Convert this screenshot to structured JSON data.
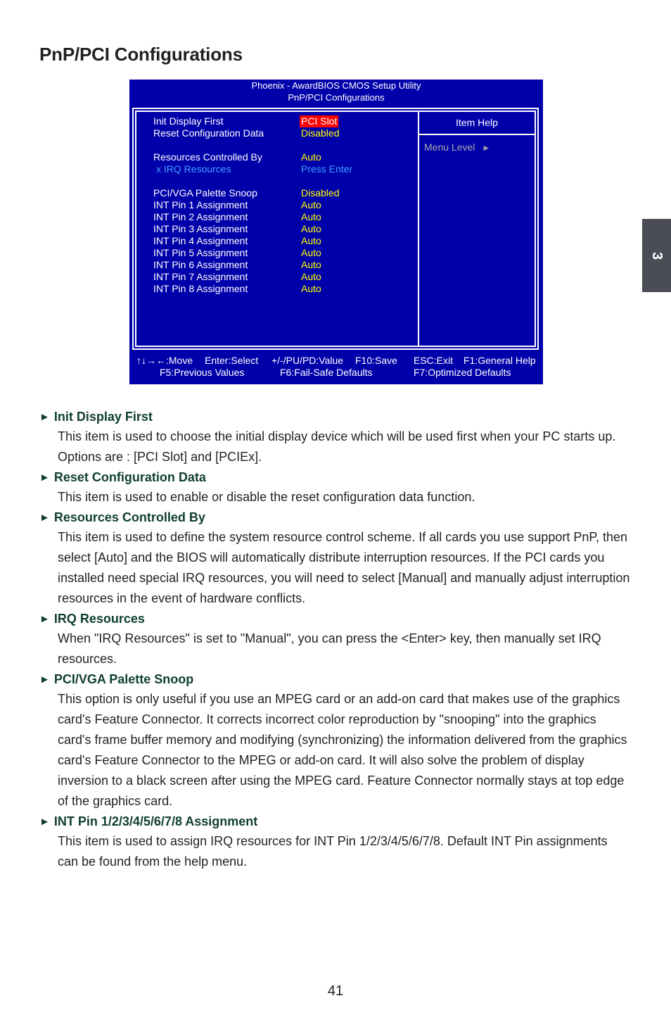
{
  "page": {
    "title": "PnP/PCI Configurations",
    "chapter_tab": "3",
    "page_number": "41"
  },
  "bios": {
    "header_line1": "Phoenix - AwardBIOS CMOS Setup Utility",
    "header_line2": "PnP/PCI Configurations",
    "item_help": "Item Help",
    "menu_level": "Menu Level",
    "menu_level_icon": "triangle-right-icon",
    "rows": [
      {
        "label": "Init Display First",
        "value": "PCI Slot",
        "selected": true
      },
      {
        "label": "Reset Configuration Data",
        "value": "Disabled"
      },
      {
        "label": "Resources Controlled By",
        "value": "Auto"
      },
      {
        "label": "x IRQ Resources",
        "value": "Press Enter",
        "disabled": true
      },
      {
        "label": "PCI/VGA Palette Snoop",
        "value": "Disabled"
      },
      {
        "label": "INT Pin 1 Assignment",
        "value": "Auto"
      },
      {
        "label": "INT Pin 2 Assignment",
        "value": "Auto"
      },
      {
        "label": "INT Pin 3 Assignment",
        "value": "Auto"
      },
      {
        "label": "INT Pin 4 Assignment",
        "value": "Auto"
      },
      {
        "label": "INT Pin 5 Assignment",
        "value": "Auto"
      },
      {
        "label": "INT Pin 6 Assignment",
        "value": "Auto"
      },
      {
        "label": "INT Pin 7 Assignment",
        "value": "Auto"
      },
      {
        "label": "INT Pin 8 Assignment",
        "value": "Auto"
      }
    ],
    "footer": {
      "move": "↑↓→←:Move",
      "select": "Enter:Select",
      "value": "+/-/PU/PD:Value",
      "save": "F10:Save",
      "exit": "ESC:Exit",
      "general_help": "F1:General Help",
      "previous": "F5:Previous Values",
      "failsafe": "F6:Fail-Safe Defaults",
      "optimized": "F7:Optimized Defaults"
    },
    "colors": {
      "background": "#0000aa",
      "value": "#ffff00",
      "disabled": "#3fa0ff",
      "selected_bg": "#ff0000",
      "menu_level": "#a8a8a8"
    }
  },
  "sections": [
    {
      "heading": "Init Display First",
      "body": "This item is used to choose the initial display device which will be used first when your PC starts up. Options are : [PCI Slot] and [PCIEx]."
    },
    {
      "heading": "Reset Configuration Data",
      "body": "This item is used to enable or disable the reset configuration data function."
    },
    {
      "heading": "Resources Controlled By",
      "body": "This item is used to define the system resource control scheme. If all cards you use support PnP, then select [Auto] and the BIOS will automatically distribute interruption resources. If the PCI cards you installed need special IRQ resources, you will need to select [Manual] and manually adjust interruption resources in the event of hardware conflicts."
    },
    {
      "heading": "IRQ Resources",
      "body": "When \"IRQ Resources\" is set to \"Manual\", you can press the <Enter> key, then manually set IRQ resources."
    },
    {
      "heading": "PCI/VGA Palette Snoop",
      "body": "This option is only useful if you use an MPEG card or an add-on card that makes use of the graphics card's Feature Connector. It corrects incorrect color reproduction by \"snooping\" into the graphics card's frame buffer memory and modifying (synchronizing) the information delivered from the graphics card's Feature Connector to the MPEG or add-on card. It will also solve the problem of display inversion to a black screen after using the MPEG card. Feature Connector normally stays at top edge of the graphics card."
    },
    {
      "heading": "INT Pin 1/2/3/4/5/6/7/8 Assignment",
      "body": "This item is used to assign IRQ resources for INT Pin 1/2/3/4/5/6/7/8. Default INT Pin assignments can be found from the help menu."
    }
  ],
  "section_arrow": "►"
}
